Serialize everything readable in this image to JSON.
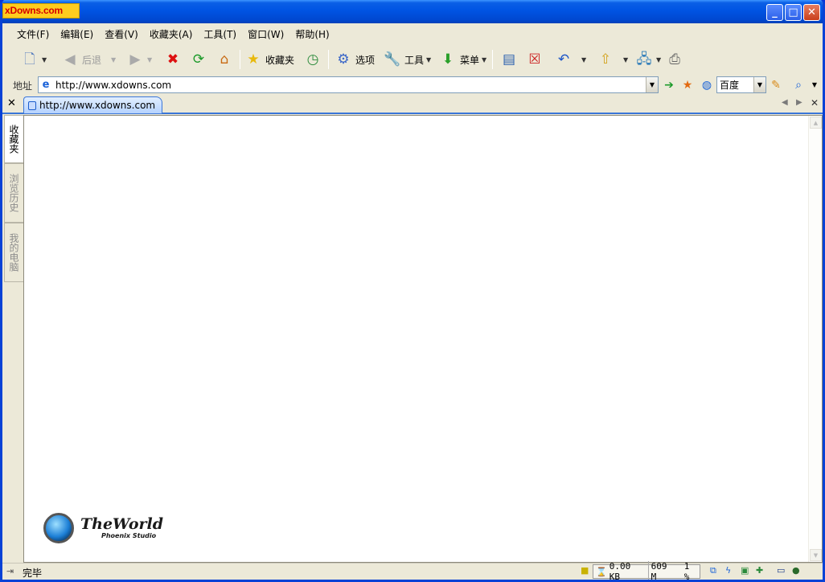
{
  "window": {
    "brand": "xDowns.com",
    "buttons": {
      "minimize": "_",
      "maximize": "□",
      "close": "✕"
    }
  },
  "menu": [
    {
      "label": "文件(F)"
    },
    {
      "label": "编辑(E)"
    },
    {
      "label": "查看(V)"
    },
    {
      "label": "收藏夹(A)"
    },
    {
      "label": "工具(T)"
    },
    {
      "label": "窗口(W)"
    },
    {
      "label": "帮助(H)"
    }
  ],
  "toolbar": {
    "back_label": "后退",
    "favorites_label": "收藏夹",
    "options_label": "选项",
    "tools_label": "工具",
    "menu_label": "菜单"
  },
  "address": {
    "label": "地址",
    "url": "http://www.xdowns.com",
    "search_engine": "百度"
  },
  "tabs": [
    {
      "title": "http://www.xdowns.com",
      "active": true
    }
  ],
  "sidebar": {
    "tabs": [
      {
        "label": "收藏夹",
        "active": true
      },
      {
        "label": "浏览历史",
        "active": false
      },
      {
        "label": "我的电脑",
        "active": false
      }
    ]
  },
  "content": {
    "brand_name": "TheWorld",
    "brand_sub": "Phoenix Studio"
  },
  "status": {
    "text": "完毕",
    "speed": "0.00 KB",
    "memory": "609 M",
    "cpu": "1 %"
  },
  "colors": {
    "titlebar": "#0054e3",
    "chrome": "#ece9d8",
    "tab_accent": "#3a76d8"
  }
}
